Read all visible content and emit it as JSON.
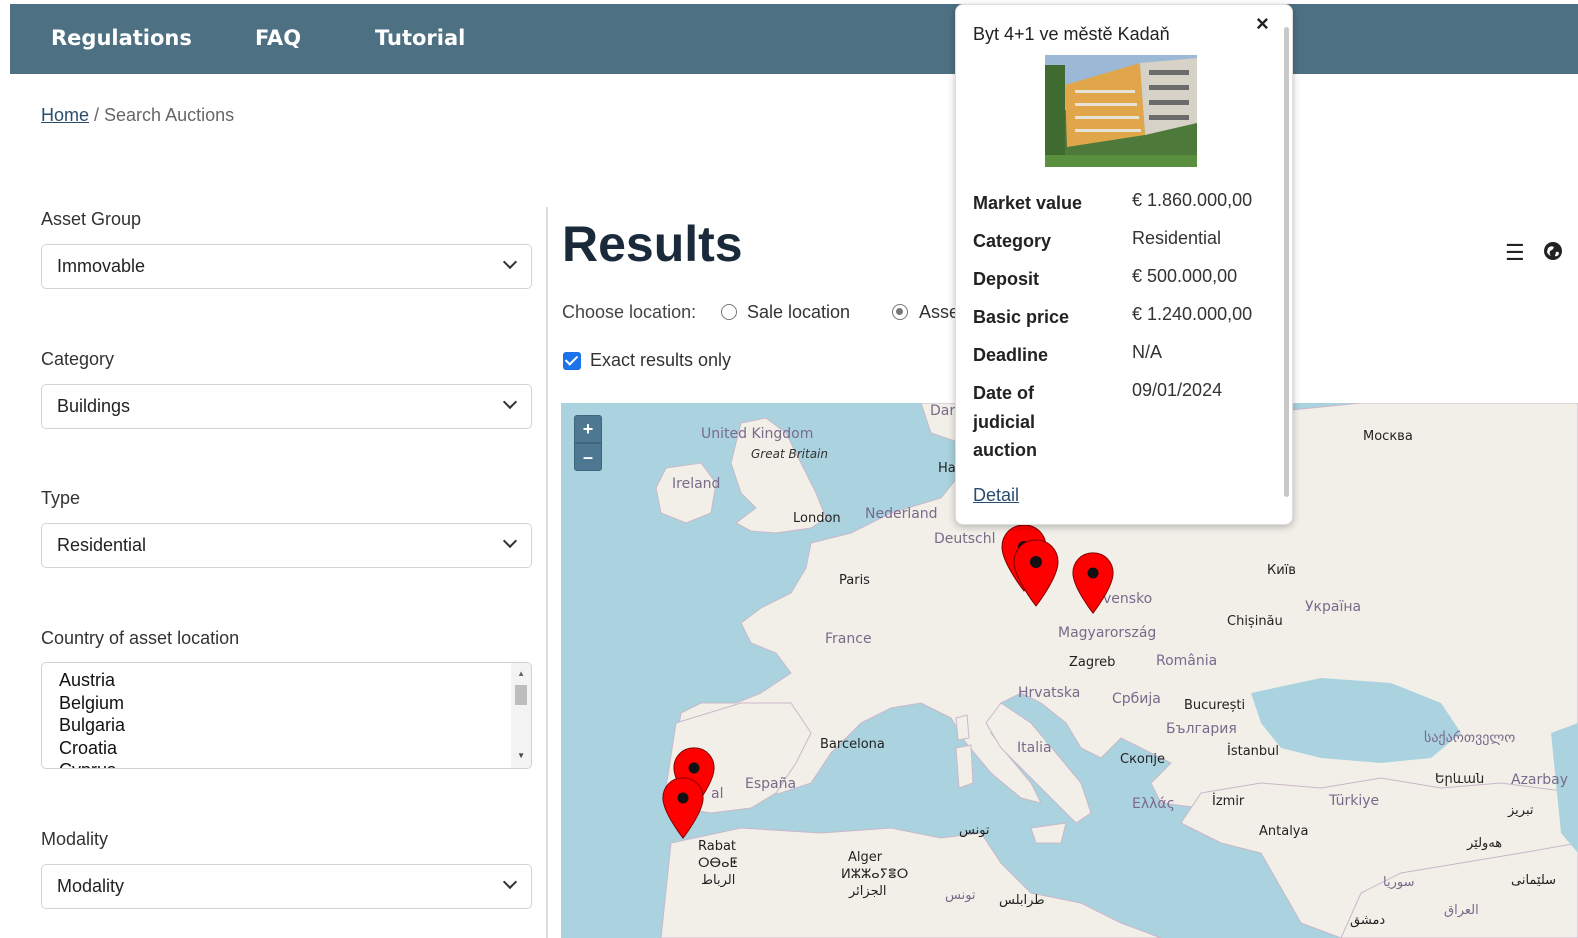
{
  "nav": {
    "regulations": "Regulations",
    "faq": "FAQ",
    "tutorial": "Tutorial"
  },
  "breadcrumb": {
    "home": "Home",
    "current": "/ Search Auctions"
  },
  "filters": {
    "asset_group": {
      "label": "Asset Group",
      "value": "Immovable"
    },
    "category": {
      "label": "Category",
      "value": "Buildings"
    },
    "type": {
      "label": "Type",
      "value": "Residential"
    },
    "country": {
      "label": "Country of asset location",
      "options": [
        "Austria",
        "Belgium",
        "Bulgaria",
        "Croatia",
        "Cyprus"
      ]
    },
    "modality": {
      "label": "Modality",
      "value": "Modality"
    }
  },
  "results": {
    "title": "Results",
    "choose_label": "Choose location:",
    "sale_location": "Sale location",
    "asset_location": "Asse",
    "exact_only": "Exact results only",
    "list_icon": "list-icon",
    "globe_icon": "globe-icon"
  },
  "map": {
    "zoom_in": "+",
    "zoom_out": "–",
    "labels": {
      "united_kingdom": "United Kingdom",
      "great_britain": "Great Britain",
      "ireland": "Ireland",
      "london": "London",
      "nederland": "Nederland",
      "deutschland": "Deutschl",
      "dan": "Dar",
      "ha": "Ha",
      "paris": "Paris",
      "france": "France",
      "moskva": "Москва",
      "kyiv": "Київ",
      "ukraina": "Україна",
      "chisinau": "Chișinău",
      "slovensko": "vensko",
      "magyarorszag": "Magyarország",
      "zagreb": "Zagreb",
      "romania": "România",
      "hrvatska": "Hrvatska",
      "srbija": "Србија",
      "bucuresti": "București",
      "balgaria": "България",
      "barcelona": "Barcelona",
      "italia": "Italia",
      "skopje": "Скопје",
      "istanbul": "İstanbul",
      "sakartvelo": "საქართველო",
      "yerevan": "Երևան",
      "azarbay": "Azarbay",
      "espana": "España",
      "portugal": "al",
      "ellas": "Ελλάς",
      "izmir": "İzmir",
      "turkiye": "Türkiye",
      "antalya": "Antalya",
      "rabat": "Rabat",
      "rabat_tif": "ⵔⴱⴰⵟ",
      "rabat_ar": "الرباط",
      "alger": "Alger",
      "alger_tif": "ⵍⵣⵣⴰⵢⴻⵔ",
      "alger_ar": "الجزائر",
      "tunis": "تونس",
      "tunis2": "تونس",
      "tarabulus": "طرابلس",
      "tabriz": "تبریز",
      "hawler": "هەولێر",
      "suriya": "سوريا",
      "sulaimani": "سلێمانی",
      "iraq": "العراق",
      "dimashq": "دمشق"
    }
  },
  "popup": {
    "title": "Byt 4+1 ve městě Kadaň",
    "close": "×",
    "rows": [
      {
        "label": "Market value",
        "value": "€ 1.860.000,00"
      },
      {
        "label": "Category",
        "value": "Residential"
      },
      {
        "label": "Deposit",
        "value": "€ 500.000,00"
      },
      {
        "label": "Basic price",
        "value": "€ 1.240.000,00"
      },
      {
        "label": "Deadline",
        "value": "N/A"
      },
      {
        "label": "Date of judicial auction",
        "value": "09/01/2024"
      }
    ],
    "detail": "Detail"
  },
  "colors": {
    "nav_bg": "#4d7083",
    "sea": "#aad3df",
    "land": "#f2efe9",
    "marker": "#ff0000",
    "link": "#2a4d6e",
    "checkbox": "#1a73e8"
  }
}
